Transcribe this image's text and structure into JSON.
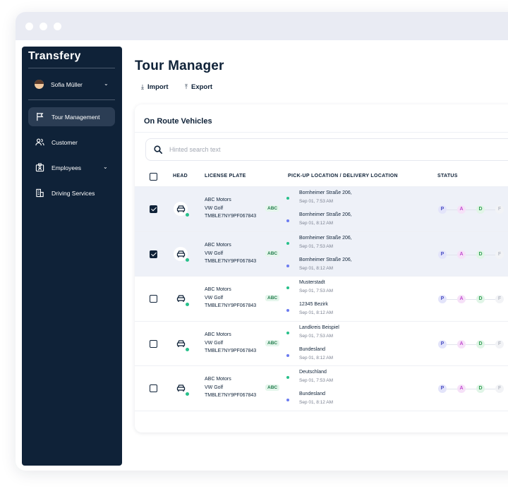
{
  "app": {
    "brand": "Transfery"
  },
  "sidebar": {
    "user_name": "Sofia Müller",
    "items": [
      {
        "label": "Tour Management",
        "icon": "flag-icon"
      },
      {
        "label": "Customer",
        "icon": "users-icon"
      },
      {
        "label": "Employees",
        "icon": "id-card-icon"
      },
      {
        "label": "Driving Services",
        "icon": "building-icon"
      }
    ]
  },
  "page": {
    "title": "Tour Manager",
    "import_label": "Import",
    "export_label": "Export"
  },
  "card": {
    "title": "On Route Vehicles",
    "search_placeholder": "Hinted search text"
  },
  "table": {
    "headers": [
      "HEAD",
      "LICENSE PLATE",
      "PICK-UP LOCATION / DELIVERY LOCATION",
      "STATUS"
    ],
    "rows": [
      {
        "checked": true,
        "company": "ABC Motors",
        "model": "VW Golf",
        "plate": "TMBLE7NY9PF067843",
        "tag": "ABC",
        "pickup": "Bornheimer Straße 206,",
        "pickup_time": "Sep 01, 7:53 AM",
        "delivery": "Bornheimer Straße 206,",
        "delivery_time": "Sep 01, 8:12 AM"
      },
      {
        "checked": true,
        "company": "ABC Motors",
        "model": "VW Golf",
        "plate": "TMBLE7NY9PF067843",
        "tag": "ABC",
        "pickup": "Bornheimer Straße 206,",
        "pickup_time": "Sep 01, 7:53 AM",
        "delivery": "Bornheimer Straße 206,",
        "delivery_time": "Sep 01, 8:12 AM"
      },
      {
        "checked": false,
        "company": "ABC Motors",
        "model": "VW Golf",
        "plate": "TMBLE7NY9PF067843",
        "tag": "ABC",
        "pickup": "Musterstadt",
        "pickup_time": "Sep 01, 7:53 AM",
        "delivery": "12345 Bezirk",
        "delivery_time": "Sep 01, 8:12 AM"
      },
      {
        "checked": false,
        "company": "ABC Motors",
        "model": "VW Golf",
        "plate": "TMBLE7NY9PF067843",
        "tag": "ABC",
        "pickup": "Landkreis Beispiel",
        "pickup_time": "Sep 01, 7:53 AM",
        "delivery": "Bundesland",
        "delivery_time": "Sep 01, 8:12 AM"
      },
      {
        "checked": false,
        "company": "ABC Motors",
        "model": "VW Golf",
        "plate": "TMBLE7NY9PF067843",
        "tag": "ABC",
        "pickup": "Deutschland",
        "pickup_time": "Sep 01, 7:53 AM",
        "delivery": "Bundesland",
        "delivery_time": "Sep 01, 8:12 AM"
      }
    ],
    "status_steps": [
      {
        "letter": "P",
        "color": "#4b4fc4",
        "bg": "#e3e4fa"
      },
      {
        "letter": "A",
        "color": "#c24bd0",
        "bg": "#f6e1f8"
      },
      {
        "letter": "D",
        "color": "#2f9e52",
        "bg": "#e1f5e7"
      },
      {
        "letter": "F",
        "color": "#b8bcc6",
        "bg": "#f2f3f6"
      }
    ]
  },
  "colors": {
    "sidebar": "#0f2238",
    "accent": "#27c08a",
    "pickup_dot": "#27c08a",
    "delivery_dot": "#6b7bf0"
  }
}
